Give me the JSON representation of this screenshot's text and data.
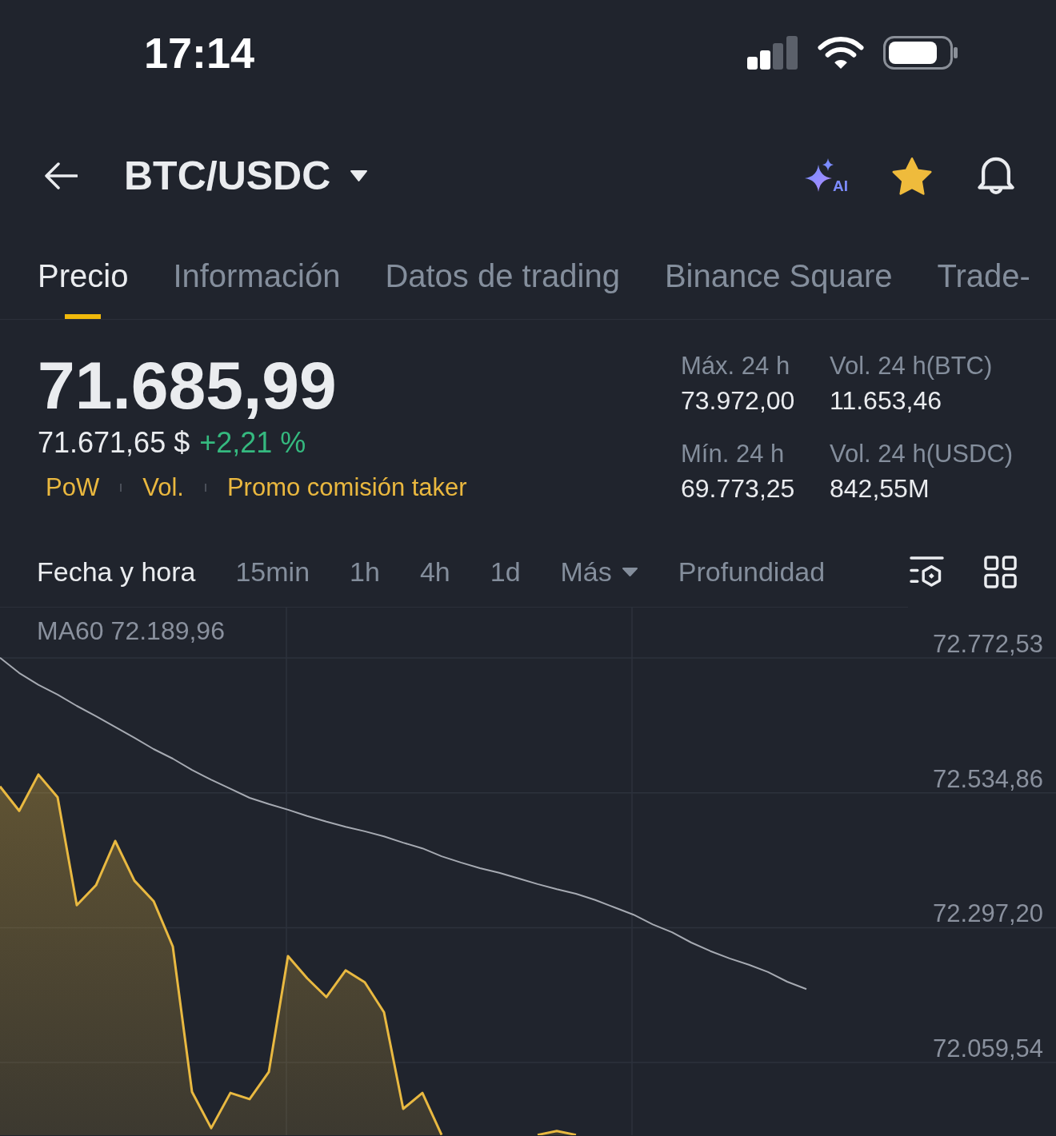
{
  "status_bar": {
    "time": "17:14"
  },
  "header": {
    "title": "BTC/USDC",
    "ai_label": "AI",
    "favorite": true
  },
  "tabs": [
    {
      "label": "Precio",
      "selected": true
    },
    {
      "label": "Información",
      "selected": false
    },
    {
      "label": "Datos de trading",
      "selected": false
    },
    {
      "label": "Binance Square",
      "selected": false
    },
    {
      "label": "Trade-",
      "selected": false
    }
  ],
  "ticker": {
    "last_price": "71.685,99",
    "fiat_price": "71.671,65 $",
    "change": "+2,21 %",
    "rising": true,
    "tags": [
      "PoW",
      "Vol.",
      "Promo comisión taker"
    ]
  },
  "stats": [
    {
      "label": "Máx. 24 h",
      "value": "73.972,00"
    },
    {
      "label": "Vol. 24 h(BTC)",
      "value": "11.653,46"
    },
    {
      "label": "Mín. 24 h",
      "value": "69.773,25"
    },
    {
      "label": "Vol. 24 h(USDC)",
      "value": "842,55M"
    }
  ],
  "chart_toolbar": {
    "intervals": [
      {
        "label": "Fecha y hora",
        "kind": "option",
        "selected": true
      },
      {
        "label": "15min",
        "kind": "option",
        "selected": false
      },
      {
        "label": "1h",
        "kind": "option",
        "selected": false
      },
      {
        "label": "4h",
        "kind": "option",
        "selected": false
      },
      {
        "label": "1d",
        "kind": "option",
        "selected": false
      },
      {
        "label": "Más",
        "kind": "dropdown",
        "selected": false
      },
      {
        "label": "Profundidad",
        "kind": "option",
        "selected": false
      }
    ]
  },
  "chart": {
    "legend_value": "72.189,96",
    "chart_data": {
      "type": "area",
      "grid": true,
      "categories": [
        null,
        null,
        null,
        null,
        null,
        null,
        null,
        null,
        null,
        null,
        null,
        null,
        null,
        null,
        null,
        null,
        null,
        null,
        null,
        null,
        null,
        null,
        null,
        null,
        null,
        null,
        null,
        null,
        null,
        null,
        null,
        null,
        null,
        null,
        null,
        null,
        null,
        null,
        null,
        null,
        null,
        null,
        null,
        null,
        null,
        null,
        null,
        null,
        null,
        null,
        null,
        null,
        null,
        null,
        null,
        null
      ],
      "series": [
        {
          "color": "#e9b941",
          "values": [
            72546,
            72503,
            72567,
            72527,
            72337,
            72372,
            72450,
            72380,
            72344,
            72264,
            72008,
            71944,
            72006,
            71995,
            72043,
            72247,
            72208,
            72175,
            72222,
            72201,
            72148,
            71978,
            72006,
            71932,
            null,
            null,
            null,
            null,
            71932,
            71939,
            71932,
            null,
            null,
            null,
            null,
            null,
            null,
            null,
            null,
            null,
            null,
            null,
            null,
            null,
            null,
            null,
            null,
            null,
            null,
            null,
            null,
            null,
            null,
            null,
            null,
            null
          ]
        },
        {
          "name": "MA60",
          "type": "line",
          "color": "#a6aab2",
          "values": [
            72773,
            72746,
            72725,
            72708,
            72688,
            72670,
            72651,
            72632,
            72612,
            72595,
            72575,
            72558,
            72542,
            72526,
            72515,
            72505,
            72494,
            72484,
            72475,
            72467,
            72458,
            72447,
            72437,
            72423,
            72412,
            72402,
            72394,
            72384,
            72374,
            72365,
            72357,
            72346,
            72333,
            72320,
            72303,
            72289,
            72271,
            72256,
            72243,
            72232,
            72219,
            72202,
            72189,
            null,
            null,
            null,
            null,
            null,
            null,
            null,
            null,
            null,
            null,
            null,
            null,
            null
          ]
        }
      ],
      "ylim": [
        71931.5,
        72861.3
      ],
      "yticks": [
        {
          "value": 72772.53,
          "label": "72.772,53"
        },
        {
          "value": 72534.86,
          "label": "72.534,86"
        },
        {
          "value": 72297.2,
          "label": "72.297,20"
        },
        {
          "value": 72059.54,
          "label": "72.059,54"
        }
      ]
    }
  }
}
